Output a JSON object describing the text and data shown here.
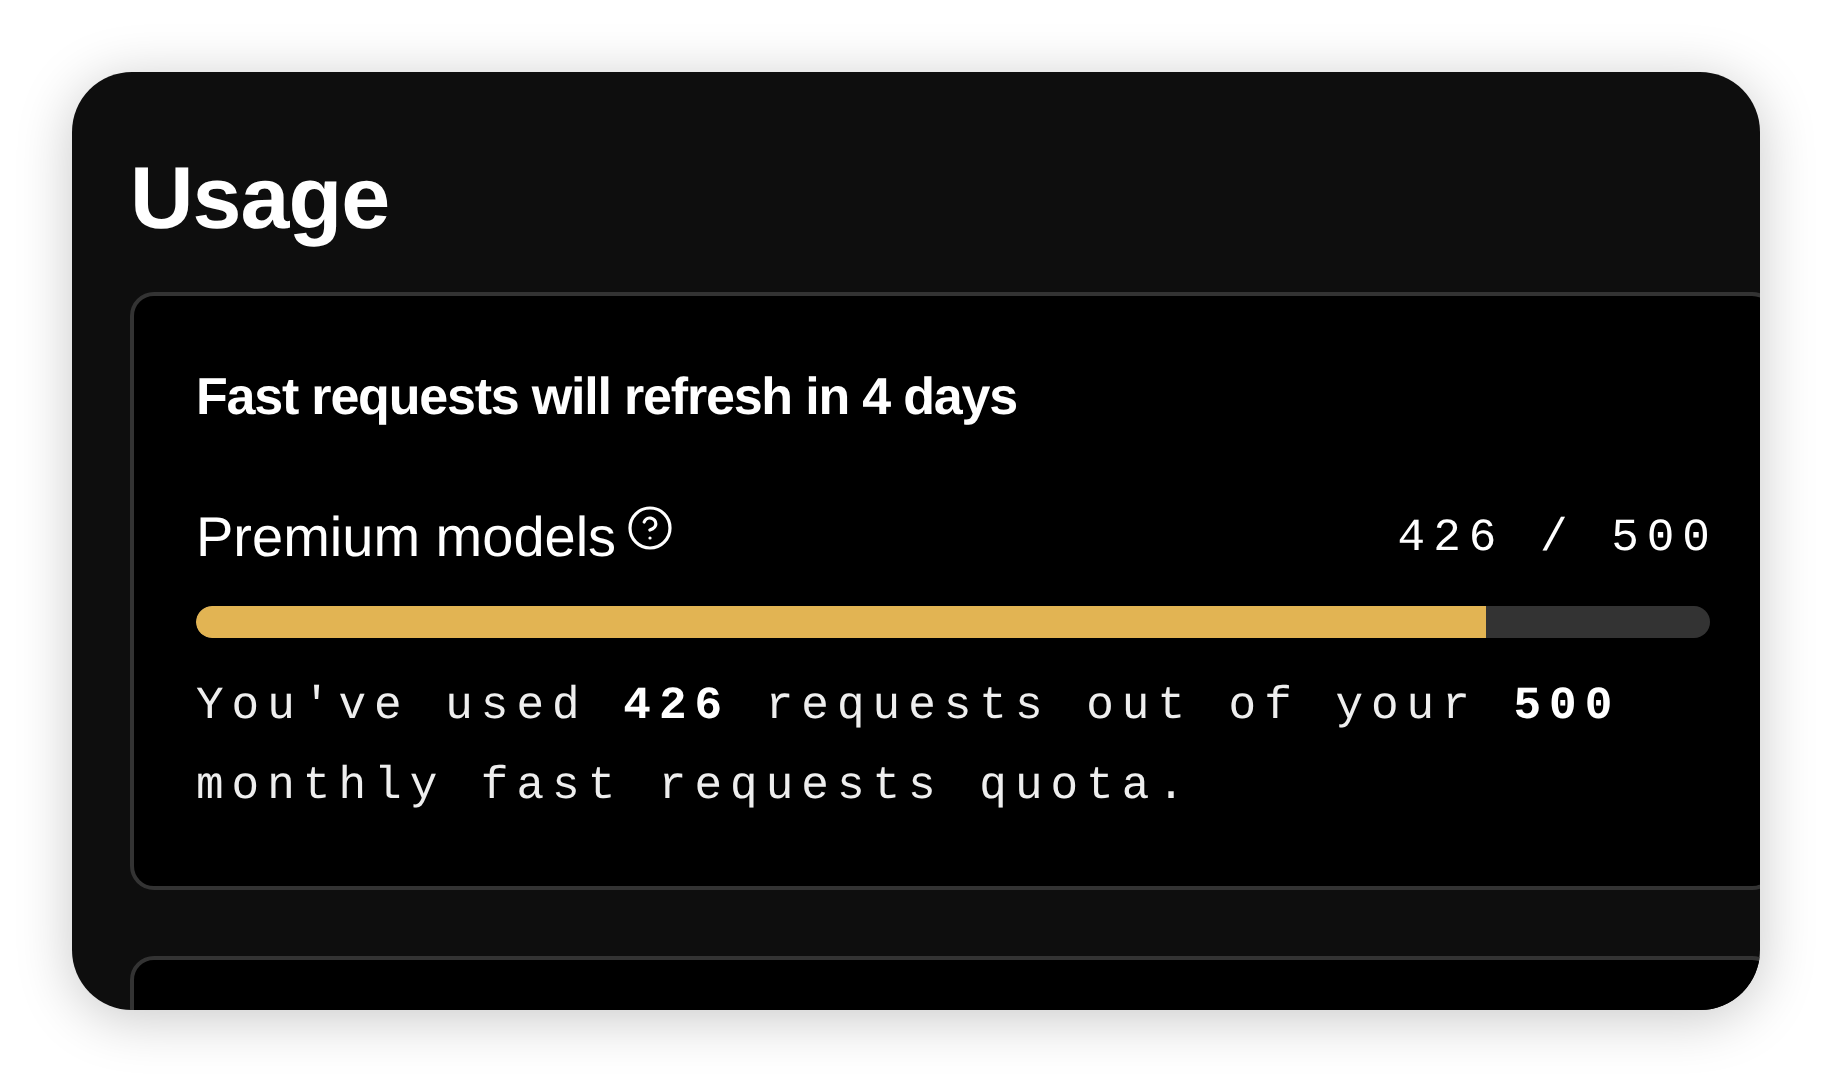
{
  "title": "Usage",
  "cards": [
    {
      "heading": "Fast requests will refresh in 4 days",
      "meter": {
        "label": "Premium models",
        "help": true,
        "count": "426 / 500",
        "level": 0.852
      },
      "description": "You've used **426** requests out of your **500** monthly fast requests quota."
    }
  ]
}
